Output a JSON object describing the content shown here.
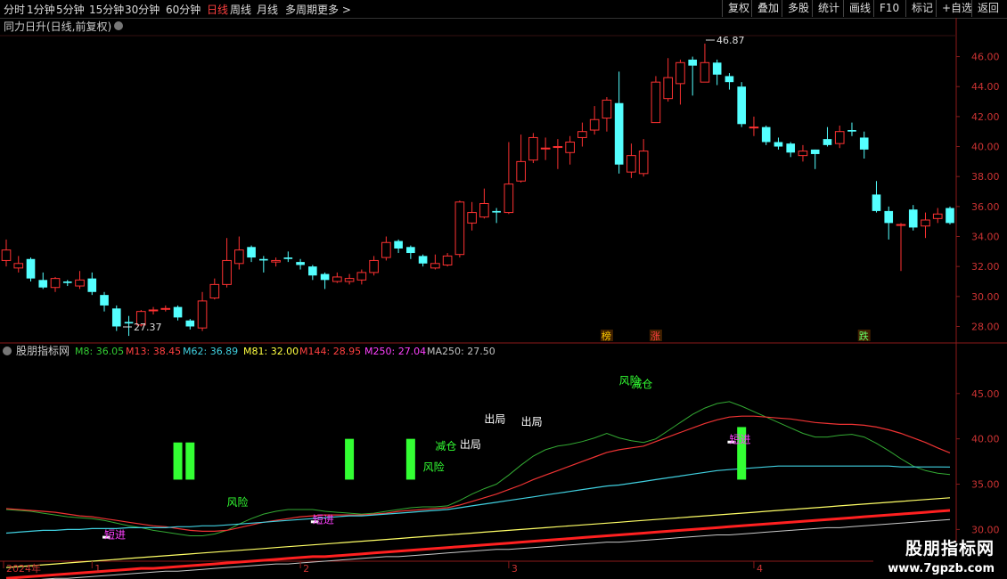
{
  "toolbar": {
    "periods": [
      "分时",
      "1分钟",
      "5分钟",
      "15分钟",
      "30分钟",
      "60分钟",
      "日线",
      "周线",
      "月线",
      "多周期",
      "更多 >"
    ],
    "active_period": "日线",
    "actions": [
      "复权",
      "叠加",
      "多股",
      "统计",
      "画线",
      "F10",
      "标记",
      "+自选",
      "返回"
    ]
  },
  "main_panel": {
    "title": "同力日升(日线,前复权)",
    "high_label": "46.87",
    "low_label": "27.37"
  },
  "indicator_panel": {
    "title": "股朋指标网",
    "items": [
      {
        "text": "M8: 36.05",
        "color": "#33cc33"
      },
      {
        "text": "M13: 38.45",
        "color": "#ff4040"
      },
      {
        "text": "M62: 36.89",
        "color": "#40d0e0"
      },
      {
        "text": "M81: 32.00",
        "color": "#ffff40"
      },
      {
        "text": "M144: 28.95",
        "color": "#ff4040"
      },
      {
        "text": "M250: 27.04",
        "color": "#ff40ff"
      },
      {
        "text": "MA250: 27.50",
        "color": "#c0c0c0"
      }
    ]
  },
  "xaxis": {
    "labels": [
      "2024年",
      "1",
      "2",
      "3",
      "4"
    ]
  },
  "watermark": {
    "name": "股朋指标网",
    "url": "www.7gpzb.com"
  },
  "chart_data": {
    "type": "candlestick",
    "y_ticks": [
      "46.00",
      "44.00",
      "42.00",
      "40.00",
      "38.00",
      "36.00",
      "34.00",
      "32.00",
      "30.00",
      "28.00"
    ],
    "ylim": [
      26.9,
      47.4
    ],
    "candles": [
      {
        "o": 32.4,
        "c": 33.1,
        "h": 33.8,
        "l": 32.0
      },
      {
        "o": 31.9,
        "c": 32.2,
        "h": 32.7,
        "l": 31.6
      },
      {
        "o": 32.5,
        "c": 31.2,
        "h": 32.6,
        "l": 31.0
      },
      {
        "o": 31.1,
        "c": 30.6,
        "h": 31.6,
        "l": 30.5
      },
      {
        "o": 30.6,
        "c": 31.2,
        "h": 31.3,
        "l": 30.3
      },
      {
        "o": 31.0,
        "c": 30.9,
        "h": 31.1,
        "l": 30.7
      },
      {
        "o": 30.7,
        "c": 31.1,
        "h": 31.7,
        "l": 30.5
      },
      {
        "o": 31.2,
        "c": 30.3,
        "h": 31.6,
        "l": 30.1
      },
      {
        "o": 30.1,
        "c": 29.4,
        "h": 30.3,
        "l": 29.0
      },
      {
        "o": 29.2,
        "c": 28.0,
        "h": 29.4,
        "l": 27.7
      },
      {
        "o": 28.3,
        "c": 28.2,
        "h": 28.7,
        "l": 27.37
      },
      {
        "o": 28.1,
        "c": 29.0,
        "h": 29.1,
        "l": 28.0
      },
      {
        "o": 29.1,
        "c": 29.1,
        "h": 29.3,
        "l": 28.8
      },
      {
        "o": 29.2,
        "c": 29.2,
        "h": 29.4,
        "l": 29.0
      },
      {
        "o": 29.3,
        "c": 28.6,
        "h": 29.4,
        "l": 28.4
      },
      {
        "o": 28.4,
        "c": 28.0,
        "h": 28.5,
        "l": 27.8
      },
      {
        "o": 27.9,
        "c": 29.7,
        "h": 30.3,
        "l": 27.7
      },
      {
        "o": 29.9,
        "c": 30.8,
        "h": 31.2,
        "l": 29.8
      },
      {
        "o": 30.8,
        "c": 32.4,
        "h": 33.9,
        "l": 30.6
      },
      {
        "o": 32.2,
        "c": 33.1,
        "h": 34.0,
        "l": 31.8
      },
      {
        "o": 33.3,
        "c": 32.6,
        "h": 33.4,
        "l": 32.3
      },
      {
        "o": 32.5,
        "c": 32.4,
        "h": 32.7,
        "l": 31.6
      },
      {
        "o": 32.3,
        "c": 32.4,
        "h": 32.6,
        "l": 32.0
      },
      {
        "o": 32.6,
        "c": 32.5,
        "h": 33.0,
        "l": 32.3
      },
      {
        "o": 32.3,
        "c": 32.1,
        "h": 32.5,
        "l": 31.8
      },
      {
        "o": 32.0,
        "c": 31.4,
        "h": 32.1,
        "l": 31.1
      },
      {
        "o": 31.5,
        "c": 31.1,
        "h": 31.6,
        "l": 30.5
      },
      {
        "o": 31.0,
        "c": 31.3,
        "h": 31.6,
        "l": 30.9
      },
      {
        "o": 31.0,
        "c": 31.2,
        "h": 31.5,
        "l": 30.8
      },
      {
        "o": 31.1,
        "c": 31.6,
        "h": 31.8,
        "l": 30.8
      },
      {
        "o": 31.6,
        "c": 32.4,
        "h": 32.7,
        "l": 31.4
      },
      {
        "o": 32.6,
        "c": 33.6,
        "h": 34.0,
        "l": 32.4
      },
      {
        "o": 33.7,
        "c": 33.2,
        "h": 33.8,
        "l": 32.9
      },
      {
        "o": 33.3,
        "c": 32.9,
        "h": 33.4,
        "l": 32.5
      },
      {
        "o": 32.7,
        "c": 32.2,
        "h": 32.8,
        "l": 32.0
      },
      {
        "o": 31.9,
        "c": 32.2,
        "h": 32.8,
        "l": 31.8
      },
      {
        "o": 32.1,
        "c": 32.7,
        "h": 32.9,
        "l": 32.0
      },
      {
        "o": 32.8,
        "c": 36.3,
        "h": 36.4,
        "l": 32.6
      },
      {
        "o": 34.9,
        "c": 35.6,
        "h": 36.3,
        "l": 34.4
      },
      {
        "o": 35.3,
        "c": 36.2,
        "h": 37.2,
        "l": 35.2
      },
      {
        "o": 35.7,
        "c": 35.6,
        "h": 35.9,
        "l": 34.9
      },
      {
        "o": 35.6,
        "c": 37.5,
        "h": 40.3,
        "l": 35.5
      },
      {
        "o": 37.7,
        "c": 39.0,
        "h": 40.8,
        "l": 37.6
      },
      {
        "o": 39.1,
        "c": 40.6,
        "h": 40.9,
        "l": 38.9
      },
      {
        "o": 39.9,
        "c": 39.9,
        "h": 40.6,
        "l": 39.1
      },
      {
        "o": 40.0,
        "c": 40.0,
        "h": 40.5,
        "l": 38.5
      },
      {
        "o": 39.6,
        "c": 40.3,
        "h": 40.7,
        "l": 38.8
      },
      {
        "o": 40.6,
        "c": 41.0,
        "h": 41.6,
        "l": 40.0
      },
      {
        "o": 41.1,
        "c": 41.8,
        "h": 42.7,
        "l": 40.8
      },
      {
        "o": 41.9,
        "c": 43.1,
        "h": 43.3,
        "l": 41.0
      },
      {
        "o": 42.9,
        "c": 38.8,
        "h": 45.0,
        "l": 38.2
      },
      {
        "o": 38.3,
        "c": 39.4,
        "h": 40.2,
        "l": 37.9
      },
      {
        "o": 38.2,
        "c": 39.7,
        "h": 40.5,
        "l": 38.0
      },
      {
        "o": 41.6,
        "c": 44.3,
        "h": 44.7,
        "l": 41.6
      },
      {
        "o": 43.2,
        "c": 44.6,
        "h": 45.9,
        "l": 43.0
      },
      {
        "o": 44.2,
        "c": 45.6,
        "h": 45.8,
        "l": 42.8
      },
      {
        "o": 45.8,
        "c": 45.4,
        "h": 46.0,
        "l": 43.4
      },
      {
        "o": 44.3,
        "c": 45.6,
        "h": 46.87,
        "l": 44.3
      },
      {
        "o": 45.6,
        "c": 44.8,
        "h": 45.8,
        "l": 44.1
      },
      {
        "o": 44.7,
        "c": 44.3,
        "h": 44.9,
        "l": 43.8
      },
      {
        "o": 44.0,
        "c": 41.5,
        "h": 44.3,
        "l": 41.3
      },
      {
        "o": 41.3,
        "c": 41.3,
        "h": 42.0,
        "l": 40.7
      },
      {
        "o": 41.3,
        "c": 40.3,
        "h": 41.4,
        "l": 40.1
      },
      {
        "o": 40.3,
        "c": 40.0,
        "h": 40.6,
        "l": 39.8
      },
      {
        "o": 40.2,
        "c": 39.6,
        "h": 40.3,
        "l": 39.3
      },
      {
        "o": 39.4,
        "c": 39.7,
        "h": 40.1,
        "l": 39.0
      },
      {
        "o": 39.8,
        "c": 39.5,
        "h": 39.8,
        "l": 38.5
      },
      {
        "o": 40.5,
        "c": 40.1,
        "h": 41.3,
        "l": 40.0
      },
      {
        "o": 40.2,
        "c": 41.0,
        "h": 41.4,
        "l": 39.9
      },
      {
        "o": 41.1,
        "c": 41.0,
        "h": 41.6,
        "l": 40.7
      },
      {
        "o": 40.6,
        "c": 39.8,
        "h": 41.0,
        "l": 39.2
      },
      {
        "o": 36.8,
        "c": 35.7,
        "h": 37.7,
        "l": 35.6
      },
      {
        "o": 35.7,
        "c": 34.9,
        "h": 36.0,
        "l": 33.8
      },
      {
        "o": 34.8,
        "c": 34.8,
        "h": 34.9,
        "l": 31.7
      },
      {
        "o": 35.8,
        "c": 34.6,
        "h": 36.1,
        "l": 34.4
      },
      {
        "o": 34.7,
        "c": 35.1,
        "h": 35.6,
        "l": 33.9
      },
      {
        "o": 35.2,
        "c": 35.5,
        "h": 35.9,
        "l": 34.9
      },
      {
        "o": 35.9,
        "c": 34.9,
        "h": 36.0,
        "l": 34.8
      }
    ],
    "event_labels": [
      {
        "text": "榜",
        "index": 49,
        "color": "#ffcc00"
      },
      {
        "text": "涨",
        "index": 53,
        "color": "#ff4040"
      },
      {
        "text": "跌",
        "index": 70,
        "color": "#66ff66"
      }
    ],
    "indicator_y_ticks": [
      "45.00",
      "40.00",
      "35.00",
      "30.00"
    ],
    "indicator_ylim": [
      26.5,
      49.5
    ],
    "indicator_series": {
      "M8": [
        32.2,
        32.1,
        32.0,
        31.8,
        31.6,
        31.4,
        31.3,
        31.2,
        31.0,
        30.7,
        30.4,
        30.2,
        29.9,
        29.7,
        29.5,
        29.3,
        29.3,
        29.5,
        29.9,
        30.6,
        31.2,
        31.7,
        32.0,
        32.2,
        32.2,
        32.2,
        32.0,
        31.9,
        31.8,
        31.7,
        31.8,
        32.0,
        32.2,
        32.4,
        32.5,
        32.5,
        32.6,
        33.2,
        33.9,
        34.5,
        35.0,
        36.0,
        37.1,
        38.1,
        38.8,
        39.2,
        39.4,
        39.7,
        40.1,
        40.6,
        40.1,
        39.8,
        39.6,
        40.0,
        40.9,
        41.8,
        42.7,
        43.4,
        43.9,
        44.1,
        43.6,
        43.0,
        42.4,
        41.8,
        41.2,
        40.6,
        40.2,
        40.2,
        40.4,
        40.5,
        40.2,
        39.5,
        38.7,
        37.8,
        37.0,
        36.5,
        36.2,
        36.05
      ],
      "M13": [
        32.3,
        32.2,
        32.1,
        32.0,
        31.9,
        31.7,
        31.5,
        31.4,
        31.2,
        31.0,
        30.8,
        30.6,
        30.4,
        30.3,
        30.1,
        29.9,
        29.8,
        29.8,
        29.9,
        30.2,
        30.5,
        30.8,
        31.0,
        31.2,
        31.4,
        31.5,
        31.6,
        31.6,
        31.6,
        31.6,
        31.7,
        31.8,
        32.0,
        32.1,
        32.2,
        32.3,
        32.4,
        32.7,
        33.1,
        33.5,
        33.9,
        34.4,
        34.9,
        35.5,
        36.0,
        36.5,
        37.0,
        37.5,
        38.0,
        38.5,
        38.8,
        39.0,
        39.2,
        39.7,
        40.2,
        40.7,
        41.2,
        41.7,
        42.1,
        42.4,
        42.5,
        42.5,
        42.4,
        42.3,
        42.2,
        42.0,
        41.8,
        41.7,
        41.6,
        41.6,
        41.5,
        41.3,
        41.0,
        40.6,
        40.1,
        39.6,
        39.0,
        38.45
      ],
      "M62": [
        29.6,
        29.7,
        29.8,
        29.9,
        29.9,
        30.0,
        30.0,
        30.1,
        30.1,
        30.1,
        30.2,
        30.2,
        30.2,
        30.2,
        30.3,
        30.3,
        30.4,
        30.4,
        30.5,
        30.6,
        30.7,
        30.8,
        30.9,
        31.0,
        31.1,
        31.2,
        31.3,
        31.4,
        31.5,
        31.5,
        31.6,
        31.7,
        31.8,
        31.9,
        32.0,
        32.1,
        32.2,
        32.4,
        32.6,
        32.8,
        33.0,
        33.2,
        33.4,
        33.6,
        33.8,
        34.0,
        34.2,
        34.4,
        34.6,
        34.8,
        34.9,
        35.1,
        35.3,
        35.5,
        35.7,
        35.9,
        36.1,
        36.3,
        36.5,
        36.6,
        36.7,
        36.8,
        36.9,
        37.0,
        37.0,
        37.0,
        37.0,
        37.0,
        37.0,
        37.0,
        37.0,
        37.0,
        37.0,
        36.9,
        36.9,
        36.9,
        36.9,
        36.89
      ],
      "M81": [
        25.8,
        25.9,
        26.0,
        26.1,
        26.2,
        26.3,
        26.4,
        26.5,
        26.6,
        26.7,
        26.8,
        26.9,
        27.0,
        27.1,
        27.2,
        27.3,
        27.4,
        27.5,
        27.6,
        27.7,
        27.8,
        27.9,
        28.0,
        28.1,
        28.2,
        28.3,
        28.4,
        28.5,
        28.6,
        28.7,
        28.8,
        28.9,
        29.0,
        29.1,
        29.2,
        29.3,
        29.4,
        29.5,
        29.6,
        29.7,
        29.8,
        29.9,
        30.0,
        30.1,
        30.2,
        30.3,
        30.4,
        30.5,
        30.6,
        30.7,
        30.8,
        30.9,
        31.0,
        31.1,
        31.2,
        31.3,
        31.4,
        31.5,
        31.6,
        31.7,
        31.8,
        31.9,
        32.0,
        32.1,
        32.2,
        32.3,
        32.4,
        32.5,
        32.6,
        32.7,
        32.8,
        32.9,
        33.0,
        33.1,
        33.2,
        33.3,
        33.4,
        33.5
      ],
      "M144": [
        24.6,
        24.7,
        24.8,
        24.9,
        25.0,
        25.1,
        25.2,
        25.3,
        25.4,
        25.5,
        25.6,
        25.7,
        25.7,
        25.8,
        25.9,
        26.0,
        26.1,
        26.2,
        26.3,
        26.4,
        26.5,
        26.6,
        26.7,
        26.8,
        26.9,
        27.0,
        27.0,
        27.1,
        27.2,
        27.3,
        27.4,
        27.5,
        27.6,
        27.7,
        27.8,
        27.9,
        28.0,
        28.1,
        28.2,
        28.3,
        28.4,
        28.5,
        28.6,
        28.7,
        28.8,
        28.9,
        29.0,
        29.1,
        29.2,
        29.3,
        29.4,
        29.5,
        29.6,
        29.7,
        29.8,
        29.9,
        30.0,
        30.1,
        30.2,
        30.3,
        30.4,
        30.5,
        30.6,
        30.7,
        30.8,
        30.9,
        31.0,
        31.1,
        31.2,
        31.3,
        31.4,
        31.5,
        31.6,
        31.7,
        31.8,
        31.9,
        32.0,
        32.1
      ],
      "MA250": [
        24.2,
        24.3,
        24.4,
        24.5,
        24.6,
        24.6,
        24.7,
        24.8,
        24.9,
        25.0,
        25.1,
        25.2,
        25.3,
        25.4,
        25.4,
        25.5,
        25.6,
        25.7,
        25.8,
        25.9,
        26.0,
        26.1,
        26.2,
        26.2,
        26.3,
        26.4,
        26.5,
        26.6,
        26.7,
        26.8,
        26.9,
        27.0,
        27.0,
        27.1,
        27.2,
        27.3,
        27.4,
        27.5,
        27.6,
        27.7,
        27.8,
        27.8,
        27.9,
        28.0,
        28.1,
        28.2,
        28.3,
        28.4,
        28.5,
        28.6,
        28.6,
        28.7,
        28.8,
        28.9,
        29.0,
        29.1,
        29.2,
        29.3,
        29.4,
        29.4,
        29.5,
        29.6,
        29.7,
        29.8,
        29.9,
        30.0,
        30.1,
        30.2,
        30.2,
        30.3,
        30.4,
        30.5,
        30.6,
        30.7,
        30.8,
        30.9,
        31.0,
        31.1
      ]
    },
    "indicator_bars": [
      {
        "index": 14,
        "low": 35.5,
        "high": 39.6,
        "color": "#33ff33"
      },
      {
        "index": 15,
        "low": 35.5,
        "high": 39.6,
        "color": "#33ff33"
      },
      {
        "index": 28,
        "low": 35.5,
        "high": 40.0,
        "color": "#33ff33"
      },
      {
        "index": 33,
        "low": 35.5,
        "high": 40.0,
        "color": "#33ff33"
      },
      {
        "index": 60,
        "low": 35.5,
        "high": 41.3,
        "color": "#33ff33"
      }
    ],
    "indicator_labels": [
      {
        "text": "短进",
        "index": 8,
        "y": 29.0,
        "color": "#ff40ff"
      },
      {
        "text": "风险",
        "index": 18,
        "y": 32.6,
        "color": "#33ff33"
      },
      {
        "text": "短进",
        "index": 25,
        "y": 30.7,
        "color": "#ff40ff"
      },
      {
        "text": "风险",
        "index": 34,
        "y": 36.5,
        "color": "#33ff33"
      },
      {
        "text": "减仓",
        "index": 35,
        "y": 38.8,
        "color": "#33ff33"
      },
      {
        "text": "出局",
        "index": 37,
        "y": 39.0,
        "color": "#ffffff"
      },
      {
        "text": "出局",
        "index": 39,
        "y": 41.8,
        "color": "#ffffff"
      },
      {
        "text": "出局",
        "index": 42,
        "y": 41.5,
        "color": "#ffffff"
      },
      {
        "text": "风险",
        "index": 50,
        "y": 46.0,
        "color": "#33ff33"
      },
      {
        "text": "减仓",
        "index": 51,
        "y": 45.6,
        "color": "#33ff33"
      },
      {
        "text": "短进",
        "index": 59,
        "y": 39.5,
        "color": "#ff40ff"
      }
    ]
  }
}
